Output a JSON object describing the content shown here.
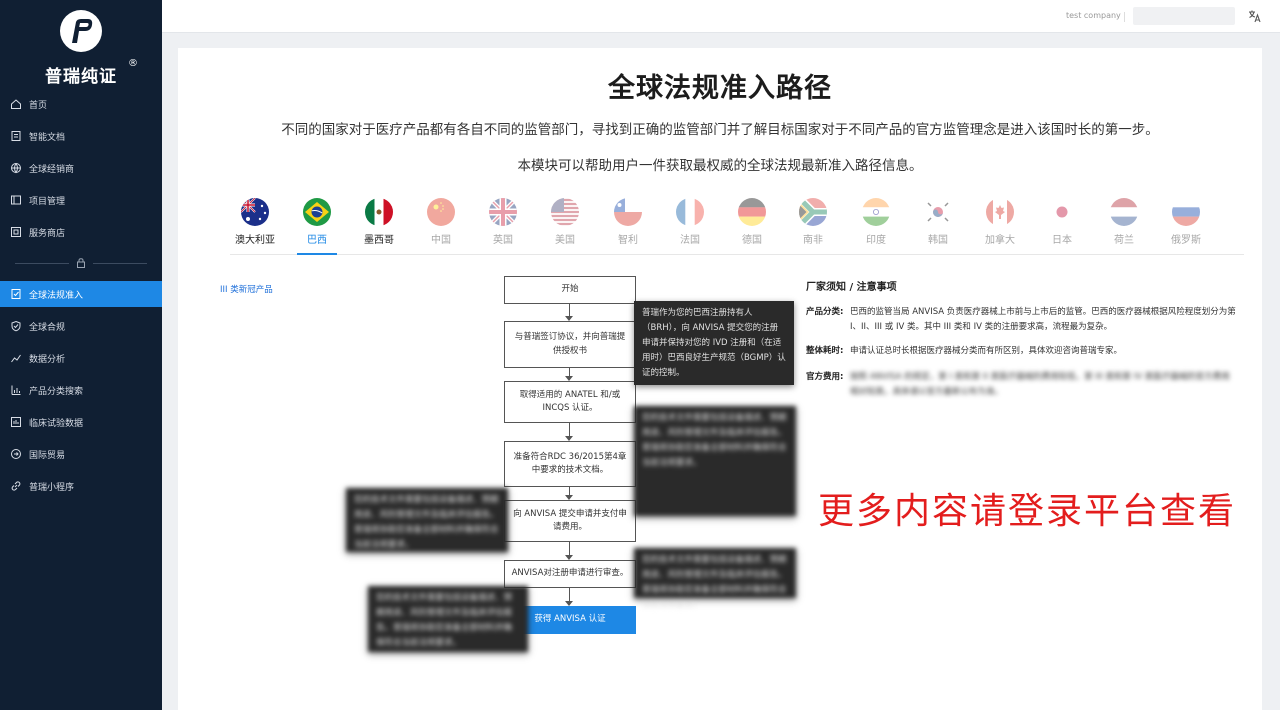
{
  "sidebar": {
    "brand": "普瑞纯证",
    "brand_reg": "®",
    "items": [
      {
        "label": "首页",
        "icon": "home-icon"
      },
      {
        "label": "智能文档",
        "icon": "document-icon"
      },
      {
        "label": "全球经销商",
        "icon": "globe-icon"
      },
      {
        "label": "项目管理",
        "icon": "project-icon"
      },
      {
        "label": "服务商店",
        "icon": "store-icon"
      },
      {
        "label": "全球法规准入",
        "icon": "regulation-icon",
        "active": true
      },
      {
        "label": "全球合规",
        "icon": "shield-icon"
      },
      {
        "label": "数据分析",
        "icon": "chart-icon"
      },
      {
        "label": "产品分类搜索",
        "icon": "bar-chart-icon"
      },
      {
        "label": "临床试验数据",
        "icon": "lab-icon"
      },
      {
        "label": "国际贸易",
        "icon": "trade-icon"
      },
      {
        "label": "普瑞小程序",
        "icon": "link-icon"
      }
    ]
  },
  "topbar": {
    "company": "test company",
    "search_placeholder": "",
    "translate_icon": "translate-icon"
  },
  "main": {
    "title": "全球法规准入路径",
    "desc1": "不同的国家对于医疗产品都有各自不同的监管部门，寻找到正确的监管部门并了解目标国家对于不同产品的官方监管理念是进入该国时长的第一步。",
    "desc2": "本模块可以帮助用户一件获取最权威的全球法规最新准入路径信息。",
    "countries": [
      {
        "label": "澳大利亚",
        "flag": "australia-flag"
      },
      {
        "label": "巴西",
        "flag": "brazil-flag",
        "selected": true
      },
      {
        "label": "墨西哥",
        "flag": "mexico-flag"
      },
      {
        "label": "中国",
        "flag": "china-flag"
      },
      {
        "label": "英国",
        "flag": "uk-flag"
      },
      {
        "label": "美国",
        "flag": "usa-flag"
      },
      {
        "label": "智利",
        "flag": "chile-flag"
      },
      {
        "label": "法国",
        "flag": "france-flag"
      },
      {
        "label": "德国",
        "flag": "germany-flag"
      },
      {
        "label": "南非",
        "flag": "south-africa-flag"
      },
      {
        "label": "印度",
        "flag": "india-flag"
      },
      {
        "label": "韩国",
        "flag": "korea-flag"
      },
      {
        "label": "加拿大",
        "flag": "canada-flag"
      },
      {
        "label": "日本",
        "flag": "japan-flag"
      },
      {
        "label": "荷兰",
        "flag": "netherlands-flag"
      },
      {
        "label": "俄罗斯",
        "flag": "russia-flag"
      }
    ],
    "category_link": "III 类新冠产品",
    "flow": [
      "开始",
      "与普瑞签订协议，并向普瑞提供授权书",
      "取得适用的 ANATEL 和/或 INCQS 认证。",
      "准备符合RDC 36/2015第4章中要求的技术文档。",
      "向 ANVISA 提交申请并支付申请费用。",
      "ANVISA对注册申请进行审查。",
      "获得 ANVISA 认证"
    ],
    "tooltip_main": "普瑞作为您的巴西注册持有人（BRH），向 ANVISA 提交您的注册申请并保持对您的 IVD 注册和（在适用时）巴西良好生产规范（BGMP）认证的控制。",
    "blurred_text": "您的技术文件需要包括设备描述、预期用途、风险管理文件及临床评估报告。普瑞将协助您准备全部材料并确保符合当前法规要求。",
    "notes": {
      "title": "厂家须知 / 注意事项",
      "rows": [
        {
          "key": "产品分类:",
          "value": "巴西的监管当局 ANVISA 负责医疗器械上市前与上市后的监管。巴西的医疗器械根据风险程度划分为第 I、II、III 或 IV 类。其中 III 类和 IV 类的注册要求高，流程最为复杂。"
        },
        {
          "key": "整体耗时:",
          "value": "申请认证总时长根据医疗器械分类而有所区别，具体欢迎咨询普瑞专家。"
        },
        {
          "key": "官方费用:",
          "value": "按照 ANVISA 的规定，第 I 类和第 II 类医疗器械的费用较低，第 III 类和第 IV 类医疗器械的官方费用相对较高，具体请以官方最新公布为准。"
        }
      ]
    },
    "promo": "更多内容请登录平台查看"
  }
}
